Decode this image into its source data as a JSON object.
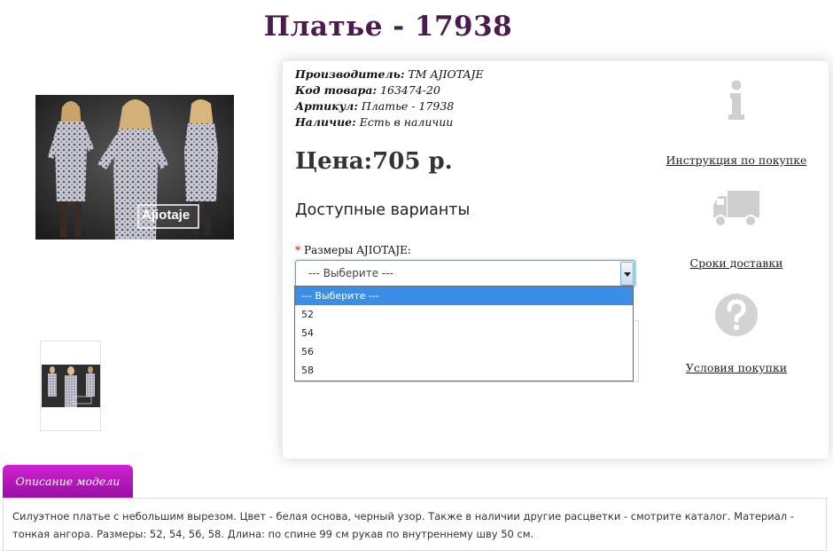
{
  "product": {
    "title": "Платье - 17938",
    "info": {
      "manufacturer_label": "Производитель:",
      "manufacturer_value": "ТМ AJIOTAJE",
      "code_label": "Код товара:",
      "code_value": "163474-20",
      "article_label": "Артикул:",
      "article_value": "Платье - 17938",
      "stock_label": "Наличие:",
      "stock_value": "Есть в наличии"
    },
    "price": "Цена:705 р.",
    "variants_title": "Доступные варианты",
    "size": {
      "required_mark": "*",
      "label": "Размеры AJIOTAJE:",
      "selected": "--- Выберите ---",
      "options": [
        "--- Выберите ---",
        "52",
        "54",
        "56",
        "58"
      ]
    },
    "image_watermark": "Ajiotaje"
  },
  "sidebar": {
    "instruction_link": "Инструкция по покупке",
    "delivery_link": "Сроки доставки",
    "terms_link": "Условия покупки"
  },
  "description": {
    "tab_label": "Описание модели",
    "text": "Силуэтное платье с небольшим вырезом. Цвет - белая основа, черный узор. Также в наличии другие расцветки - смотрите каталог. Материал - тонкая ангора. Размеры: 52, 54, 56, 58. Длина: по спине 99 см рукав по внутреннему шву 50 см."
  },
  "colors": {
    "title": "#4b1a4f",
    "tab": "#b516bb",
    "select_highlight": "#3a8ee6",
    "required": "#e00000"
  }
}
